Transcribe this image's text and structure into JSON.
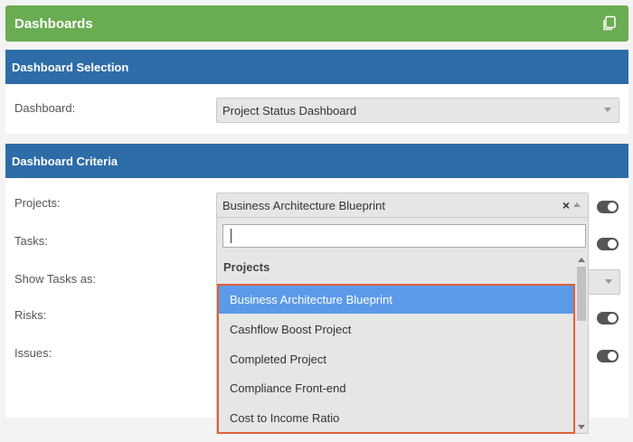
{
  "title_bar": {
    "title": "Dashboards",
    "copy_icon": "copy-icon"
  },
  "dashboard_selection": {
    "header": "Dashboard Selection",
    "dashboard_label": "Dashboard:",
    "dashboard_value": "Project Status Dashboard"
  },
  "dashboard_criteria": {
    "header": "Dashboard Criteria",
    "projects_label": "Projects:",
    "projects_value": "Business Architecture Blueprint",
    "clear_symbol": "×",
    "tasks_label": "Tasks:",
    "show_tasks_label": "Show Tasks as:",
    "risks_label": "Risks:",
    "issues_label": "Issues:"
  },
  "dropdown": {
    "search_value": "",
    "group_label": "Projects",
    "options": [
      "Business Architecture Blueprint",
      "Cashflow Boost Project",
      "Completed Project",
      "Compliance Front-end",
      "Cost to Income Ratio"
    ],
    "selected_index": 0
  },
  "colors": {
    "title_bar": "#6aac52",
    "section_header": "#2e6ca7",
    "selected_option": "#5b9ae8",
    "highlight_border": "#e0603a"
  }
}
